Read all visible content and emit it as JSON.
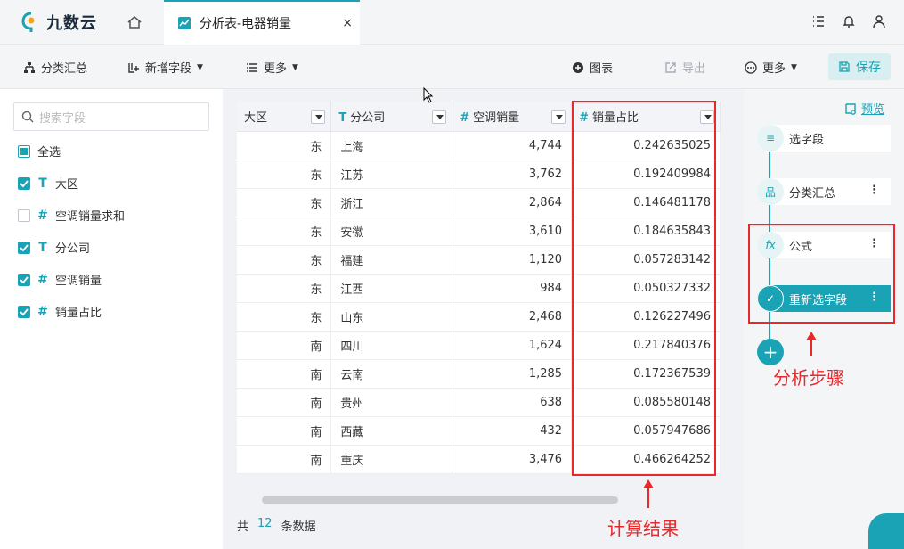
{
  "app": {
    "logo_text": "九数云"
  },
  "tab": {
    "label": "分析表-电器销量",
    "close": "×"
  },
  "toolbar": {
    "group_sum": "分类汇总",
    "add_field": "新增字段",
    "more": "更多",
    "chart": "图表",
    "export": "导出",
    "more_right": "更多",
    "save": "保存"
  },
  "left": {
    "search_placeholder": "搜索字段",
    "select_all": "全选",
    "fields": [
      {
        "type": "T",
        "name": "大区",
        "checked": true
      },
      {
        "type": "#",
        "name": "空调销量求和",
        "checked": false
      },
      {
        "type": "T",
        "name": "分公司",
        "checked": true
      },
      {
        "type": "#",
        "name": "空调销量",
        "checked": true
      },
      {
        "type": "#",
        "name": "销量占比",
        "checked": true
      }
    ]
  },
  "table": {
    "headers": [
      {
        "type": "",
        "label": "大区"
      },
      {
        "type": "T",
        "label": "分公司"
      },
      {
        "type": "#",
        "label": "空调销量"
      },
      {
        "type": "#",
        "label": "销量占比"
      }
    ],
    "rows": [
      [
        "东",
        "上海",
        "4,744",
        "0.242635025"
      ],
      [
        "东",
        "江苏",
        "3,762",
        "0.192409984"
      ],
      [
        "东",
        "浙江",
        "2,864",
        "0.146481178"
      ],
      [
        "东",
        "安徽",
        "3,610",
        "0.184635843"
      ],
      [
        "东",
        "福建",
        "1,120",
        "0.057283142"
      ],
      [
        "东",
        "江西",
        "984",
        "0.050327332"
      ],
      [
        "东",
        "山东",
        "2,468",
        "0.126227496"
      ],
      [
        "南",
        "四川",
        "1,624",
        "0.217840376"
      ],
      [
        "南",
        "云南",
        "1,285",
        "0.172367539"
      ],
      [
        "南",
        "贵州",
        "638",
        "0.085580148"
      ],
      [
        "南",
        "西藏",
        "432",
        "0.057947686"
      ],
      [
        "南",
        "重庆",
        "3,476",
        "0.466264252"
      ]
    ]
  },
  "footer": {
    "prefix": "共",
    "count": "12",
    "suffix": "条数据"
  },
  "right": {
    "preview": "预览",
    "steps": [
      {
        "label": "选字段",
        "icon": "select-fields-icon"
      },
      {
        "label": "分类汇总",
        "icon": "group-icon"
      },
      {
        "label": "公式",
        "icon": "formula-icon"
      },
      {
        "label": "重新选字段",
        "icon": "reselect-icon"
      }
    ],
    "more_glyph": "⋮"
  },
  "annotations": {
    "result": "计算结果",
    "steps": "分析步骤"
  },
  "colors": {
    "accent": "#1aa3b5",
    "annotation": "#e8282b"
  }
}
